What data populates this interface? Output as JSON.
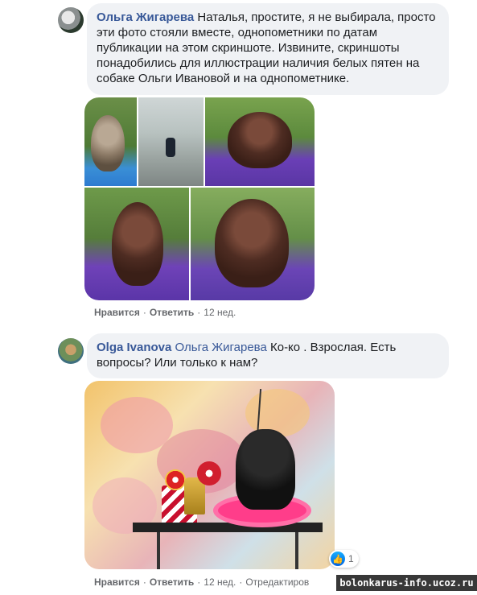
{
  "comment1": {
    "author": "Ольга Жигарева",
    "text": "Наталья, простите, я не выбирала, просто эти фото стояли вместе, однопометники по датам публикации на этом скриншоте. Извините, скриншоты понадобились для иллюстрации наличия белых пятен на собаке Ольги Ивановой и на однопометнике.",
    "actions": {
      "like": "Нравится",
      "reply": "Ответить",
      "time": "12 нед."
    }
  },
  "comment2": {
    "author": "Olga Ivanova",
    "mention": "Ольга Жигарева",
    "text": "Ко-ко . Взрослая. Есть вопросы? Или только к нам?",
    "reaction_count": "1",
    "actions": {
      "like": "Нравится",
      "reply": "Ответить",
      "time": "12 нед.",
      "edited": "Отредактиров"
    }
  },
  "watermark": "bolonkarus-info.ucoz.ru",
  "colors": {
    "link": "#385898",
    "bubble": "#f0f2f5",
    "like_blue": "#0062df"
  },
  "icons": {
    "like": "thumbs-up-icon"
  }
}
